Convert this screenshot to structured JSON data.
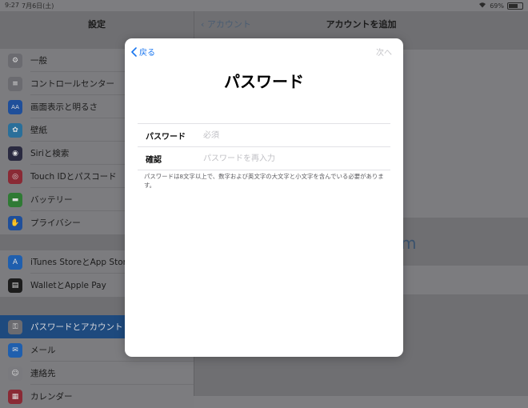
{
  "status_bar": {
    "time": "9:27",
    "date": "7月6日(土)",
    "battery": "69%"
  },
  "sidebar": {
    "title": "設定",
    "items": [
      {
        "label": "一般",
        "icon": "gear-icon",
        "color": "#6b6b70"
      },
      {
        "label": "コントロールセンター",
        "icon": "toggles-icon",
        "color": "#6b6b70"
      },
      {
        "label": "画面表示と明るさ",
        "icon": "display-aa-icon",
        "color": "#1f4f9a"
      },
      {
        "label": "壁紙",
        "icon": "flower-icon",
        "color": "#2a6f9a"
      },
      {
        "label": "Siriと検索",
        "icon": "siri-icon",
        "color": "#2a2a40"
      },
      {
        "label": "Touch IDとパスコード",
        "icon": "fingerprint-icon",
        "color": "#8a2a35"
      },
      {
        "label": "バッテリー",
        "icon": "battery-icon",
        "color": "#2f7a34"
      },
      {
        "label": "プライバシー",
        "icon": "hand-icon",
        "color": "#1f4f9a"
      },
      {
        "label": "iTunes StoreとApp Store",
        "icon": "app-store-icon",
        "color": "#1f5fae"
      },
      {
        "label": "WalletとApple Pay",
        "icon": "wallet-icon",
        "color": "#1c1c1c"
      },
      {
        "label": "パスワードとアカウント",
        "icon": "key-icon",
        "color": "#6b6b70"
      },
      {
        "label": "メール",
        "icon": "mail-icon",
        "color": "#1f5fae"
      },
      {
        "label": "連絡先",
        "icon": "contacts-icon",
        "color": "#7a7a7e"
      },
      {
        "label": "カレンダー",
        "icon": "calendar-icon",
        "color": "#8a2a35"
      }
    ]
  },
  "detail": {
    "back_label": "アカウント",
    "title": "アカウントを追加",
    "partial_text": "m"
  },
  "modal": {
    "back_label": "戻る",
    "next_label": "次へ",
    "title": "パスワード",
    "fields": [
      {
        "label": "パスワード",
        "placeholder": "必須",
        "value": ""
      },
      {
        "label": "確認",
        "placeholder": "パスワードを再入力",
        "value": ""
      }
    ],
    "note": "パスワードは8文字以上で、数字および英文字の大文字と小文字を含んでいる必要があります。"
  },
  "colors": {
    "accent": "#1a76f0",
    "selected_row": "#1e4a7e",
    "dim_overlay": "#7d7d80"
  }
}
